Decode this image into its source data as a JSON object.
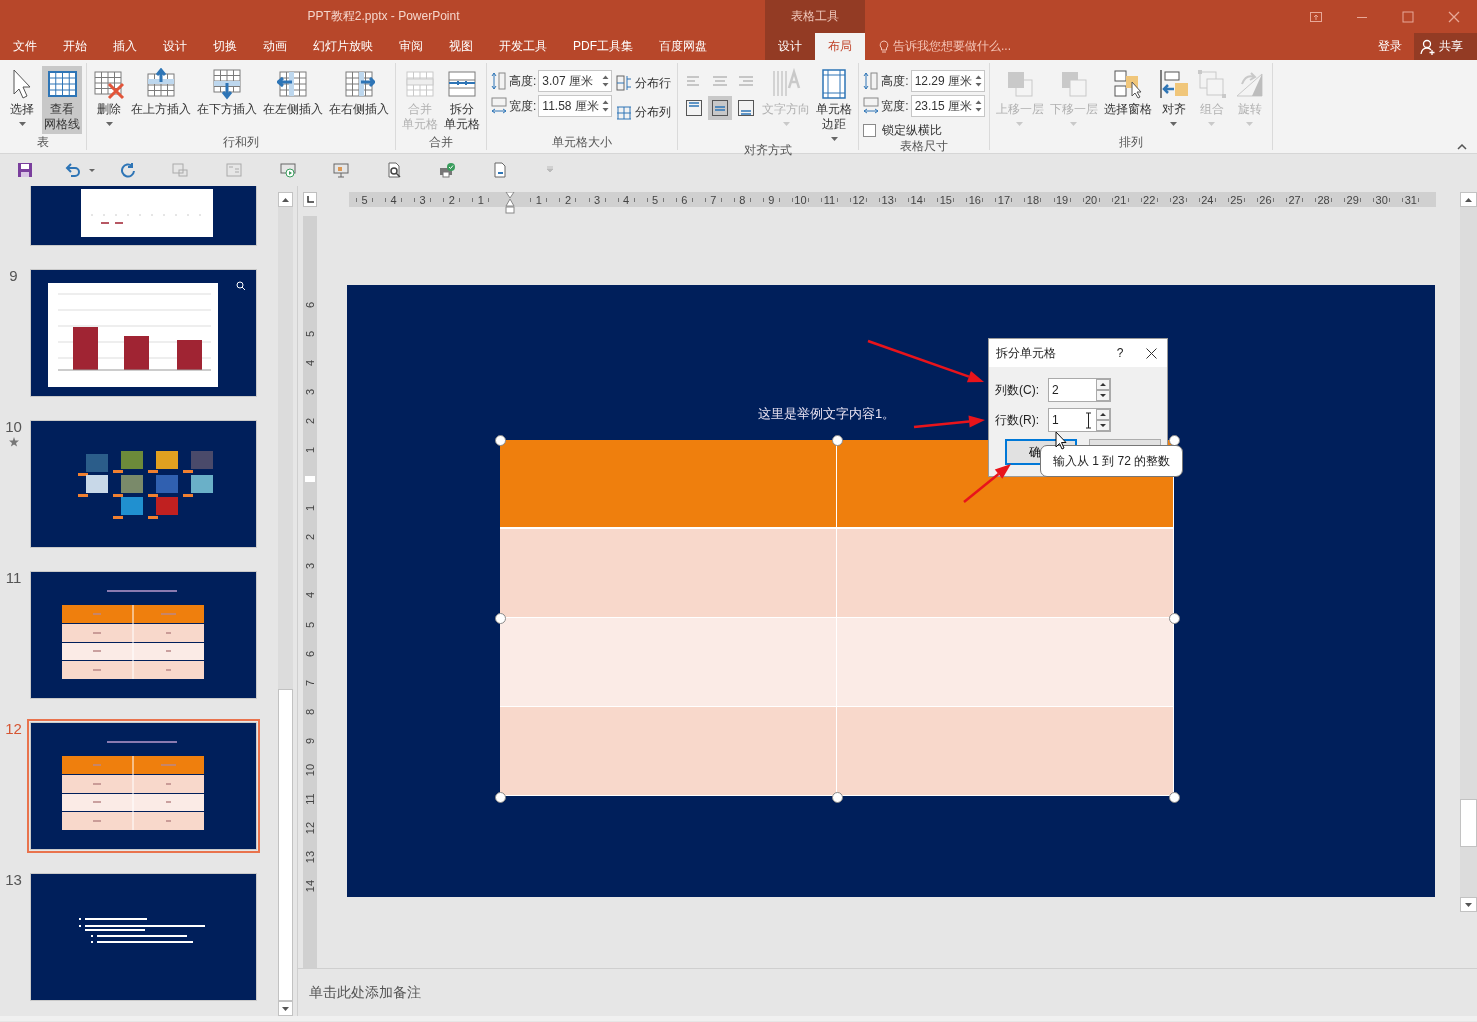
{
  "window": {
    "title": "PPT教程2.pptx - PowerPoint",
    "context_label": "表格工具"
  },
  "tabs": [
    {
      "label": "文件",
      "selected": false,
      "contextual": false
    },
    {
      "label": "开始",
      "selected": false,
      "contextual": false
    },
    {
      "label": "插入",
      "selected": false,
      "contextual": false
    },
    {
      "label": "设计",
      "selected": false,
      "contextual": false
    },
    {
      "label": "切换",
      "selected": false,
      "contextual": false
    },
    {
      "label": "动画",
      "selected": false,
      "contextual": false
    },
    {
      "label": "幻灯片放映",
      "selected": false,
      "contextual": false
    },
    {
      "label": "审阅",
      "selected": false,
      "contextual": false
    },
    {
      "label": "视图",
      "selected": false,
      "contextual": false
    },
    {
      "label": "开发工具",
      "selected": false,
      "contextual": false
    },
    {
      "label": "PDF工具集",
      "selected": false,
      "contextual": false
    },
    {
      "label": "百度网盘",
      "selected": false,
      "contextual": false
    },
    {
      "label": "设计",
      "selected": false,
      "contextual": true
    },
    {
      "label": "布局",
      "selected": true,
      "contextual": true
    }
  ],
  "tell_me": {
    "placeholder": "告诉我您想要做什么..."
  },
  "account": {
    "sign_in": "登录",
    "share": "共享"
  },
  "ribbon": {
    "groups": [
      {
        "label": "表",
        "items": [
          {
            "kind": "large",
            "lines": [
              "选择"
            ],
            "dropdown": true,
            "disabled": false,
            "selected": false
          },
          {
            "kind": "large",
            "lines": [
              "查看",
              "网格线"
            ],
            "dropdown": false,
            "disabled": false,
            "selected": true
          }
        ]
      },
      {
        "label": "行和列",
        "items": [
          {
            "kind": "large",
            "lines": [
              "删除"
            ],
            "dropdown": true,
            "disabled": false,
            "selected": false
          },
          {
            "kind": "large",
            "lines": [
              "在上方插入"
            ],
            "dropdown": false,
            "disabled": false,
            "selected": false
          },
          {
            "kind": "large",
            "lines": [
              "在下方插入"
            ],
            "dropdown": false,
            "disabled": false,
            "selected": false
          },
          {
            "kind": "large",
            "lines": [
              "在左侧插入"
            ],
            "dropdown": false,
            "disabled": false,
            "selected": false
          },
          {
            "kind": "large",
            "lines": [
              "在右侧插入"
            ],
            "dropdown": false,
            "disabled": false,
            "selected": false
          }
        ]
      },
      {
        "label": "合并",
        "items": [
          {
            "kind": "large",
            "lines": [
              "合并",
              "单元格"
            ],
            "dropdown": false,
            "disabled": true,
            "selected": false
          },
          {
            "kind": "large",
            "lines": [
              "拆分",
              "单元格"
            ],
            "dropdown": false,
            "disabled": false,
            "selected": false
          }
        ]
      },
      {
        "label": "单元格大小",
        "items": [
          {
            "kind": "column",
            "items": [
              {
                "kind": "spin",
                "label": "高度:",
                "value": "3.07 厘米"
              },
              {
                "kind": "spin",
                "label": "宽度:",
                "value": "11.58 厘米"
              }
            ]
          },
          {
            "kind": "column",
            "items": [
              {
                "kind": "small",
                "label": "分布行"
              },
              {
                "kind": "small",
                "label": "分布列"
              }
            ]
          }
        ]
      },
      {
        "label": "对齐方式",
        "items": [
          {
            "kind": "align",
            "items": [
              {
                "selected": false
              },
              {
                "selected": false
              },
              {
                "selected": false
              },
              {
                "selected": false
              },
              {
                "selected": true
              },
              {
                "selected": false
              }
            ]
          },
          {
            "kind": "large",
            "lines": [
              "文字方向"
            ],
            "dropdown": true,
            "disabled": true,
            "selected": false
          },
          {
            "kind": "large",
            "lines": [
              "单元格",
              "边距"
            ],
            "dropdown": true,
            "disabled": false,
            "selected": false
          }
        ]
      },
      {
        "label": "表格尺寸",
        "items": [
          {
            "kind": "column",
            "items": [
              {
                "kind": "spin",
                "label": "高度:",
                "value": "12.29 厘米"
              },
              {
                "kind": "spin",
                "label": "宽度:",
                "value": "23.15 厘米"
              },
              {
                "kind": "check",
                "label": "锁定纵横比",
                "checked": false
              }
            ]
          }
        ]
      },
      {
        "label": "排列",
        "items": [
          {
            "kind": "large",
            "lines": [
              "上移一层"
            ],
            "dropdown": true,
            "disabled": true,
            "selected": false
          },
          {
            "kind": "large",
            "lines": [
              "下移一层"
            ],
            "dropdown": true,
            "disabled": true,
            "selected": false
          },
          {
            "kind": "large",
            "lines": [
              "选择窗格"
            ],
            "dropdown": false,
            "disabled": false,
            "selected": false
          },
          {
            "kind": "large",
            "lines": [
              "对齐"
            ],
            "dropdown": true,
            "disabled": false,
            "selected": false
          },
          {
            "kind": "large",
            "lines": [
              "组合"
            ],
            "dropdown": true,
            "disabled": true,
            "selected": false
          },
          {
            "kind": "large",
            "lines": [
              "旋转"
            ],
            "dropdown": true,
            "disabled": true,
            "selected": false
          }
        ]
      }
    ]
  },
  "slides": [
    {
      "kind": "chart-cropped",
      "selected": false
    },
    {
      "number": "9",
      "kind": "chart",
      "selected": false,
      "animated": false
    },
    {
      "number": "10",
      "kind": "images",
      "selected": false,
      "animated": true
    },
    {
      "number": "11",
      "kind": "table",
      "selected": false,
      "animated": false
    },
    {
      "number": "12",
      "kind": "table",
      "selected": true,
      "animated": false
    },
    {
      "number": "13",
      "kind": "bullets",
      "selected": false,
      "animated": false
    }
  ],
  "ruler_horizontal": [
    "5",
    "4",
    "3",
    "2",
    "1",
    "1",
    "2",
    "3",
    "4",
    "5",
    "6",
    "7",
    "8",
    "9",
    "10",
    "11",
    "12",
    "13",
    "14",
    "15",
    "16",
    "17",
    "18",
    "19",
    "20",
    "21",
    "22",
    "23",
    "24",
    "25",
    "26",
    "27",
    "28",
    "29",
    "30",
    "31"
  ],
  "ruler_vertical": [
    "6",
    "5",
    "4",
    "3",
    "2",
    "1",
    "1",
    "2",
    "3",
    "4",
    "5",
    "6",
    "7",
    "8",
    "9",
    "10",
    "11",
    "12",
    "13",
    "14"
  ],
  "slide": {
    "text": "这里是举例文字内容1。",
    "table": {
      "rows": [
        {
          "kind": "header"
        },
        {
          "kind": "band"
        },
        {
          "kind": "plain"
        },
        {
          "kind": "band"
        }
      ]
    }
  },
  "dialog": {
    "title": "拆分单元格",
    "help": "?",
    "fields": [
      {
        "label": "列数(C):",
        "value": "2"
      },
      {
        "label": "行数(R):",
        "value": "1"
      }
    ],
    "buttons": [
      {
        "kind": "ok",
        "label": "确"
      },
      {
        "kind": "cancel"
      }
    ],
    "tooltip": "输入从 1 到 72 的整数"
  },
  "notes": {
    "placeholder": "单击此处添加备注"
  }
}
